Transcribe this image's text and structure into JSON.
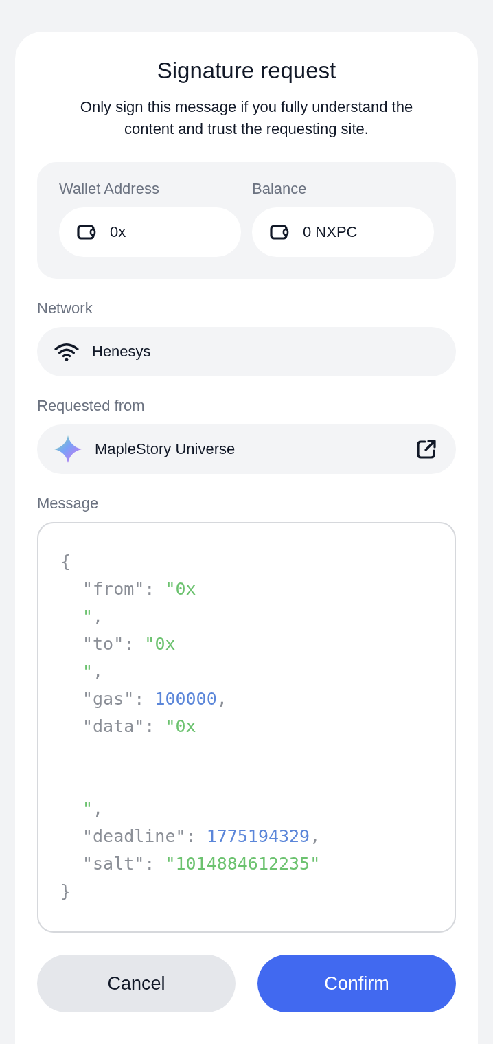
{
  "title": "Signature request",
  "subtitle": "Only sign this message if you fully understand the content and trust the requesting site.",
  "account": {
    "wallet_label": "Wallet Address",
    "wallet_value": "0x",
    "balance_label": "Balance",
    "balance_value": "0 NXPC"
  },
  "network": {
    "label": "Network",
    "value": "Henesys"
  },
  "requested_from": {
    "label": "Requested from",
    "value": "MapleStory Universe"
  },
  "message": {
    "label": "Message",
    "lines": [
      {
        "kind": "code",
        "indent": false,
        "tokens": [
          {
            "kind": "punct",
            "text": "{"
          }
        ]
      },
      {
        "kind": "code",
        "indent": true,
        "tokens": [
          {
            "kind": "key",
            "text": "\"from\""
          },
          {
            "kind": "punct",
            "text": ": "
          },
          {
            "kind": "string",
            "text": "\"0x"
          }
        ]
      },
      {
        "kind": "code",
        "indent": true,
        "tokens": [
          {
            "kind": "string",
            "text": "\""
          },
          {
            "kind": "punct",
            "text": ","
          }
        ]
      },
      {
        "kind": "code",
        "indent": true,
        "tokens": [
          {
            "kind": "key",
            "text": "\"to\""
          },
          {
            "kind": "punct",
            "text": ": "
          },
          {
            "kind": "string",
            "text": "\"0x"
          }
        ]
      },
      {
        "kind": "code",
        "indent": true,
        "tokens": [
          {
            "kind": "string",
            "text": "\""
          },
          {
            "kind": "punct",
            "text": ","
          }
        ]
      },
      {
        "kind": "code",
        "indent": true,
        "tokens": [
          {
            "kind": "key",
            "text": "\"gas\""
          },
          {
            "kind": "punct",
            "text": ": "
          },
          {
            "kind": "number",
            "text": "100000"
          },
          {
            "kind": "punct",
            "text": ","
          }
        ]
      },
      {
        "kind": "code",
        "indent": true,
        "tokens": [
          {
            "kind": "key",
            "text": "\"data\""
          },
          {
            "kind": "punct",
            "text": ": "
          },
          {
            "kind": "string",
            "text": "\"0x"
          }
        ]
      },
      {
        "kind": "gap"
      },
      {
        "kind": "gap"
      },
      {
        "kind": "code",
        "indent": true,
        "tokens": [
          {
            "kind": "string",
            "text": "\""
          },
          {
            "kind": "punct",
            "text": ","
          }
        ]
      },
      {
        "kind": "code",
        "indent": true,
        "tokens": [
          {
            "kind": "key",
            "text": "\"deadline\""
          },
          {
            "kind": "punct",
            "text": ": "
          },
          {
            "kind": "number",
            "text": "1775194329"
          },
          {
            "kind": "punct",
            "text": ","
          }
        ]
      },
      {
        "kind": "code",
        "indent": true,
        "tokens": [
          {
            "kind": "key",
            "text": "\"salt\""
          },
          {
            "kind": "punct",
            "text": ": "
          },
          {
            "kind": "string",
            "text": "\"1014884612235\""
          }
        ]
      },
      {
        "kind": "code",
        "indent": false,
        "tokens": [
          {
            "kind": "punct",
            "text": "}"
          }
        ]
      }
    ]
  },
  "buttons": [
    {
      "label": "Cancel",
      "kind": "secondary"
    },
    {
      "label": "Confirm",
      "kind": "primary"
    }
  ]
}
